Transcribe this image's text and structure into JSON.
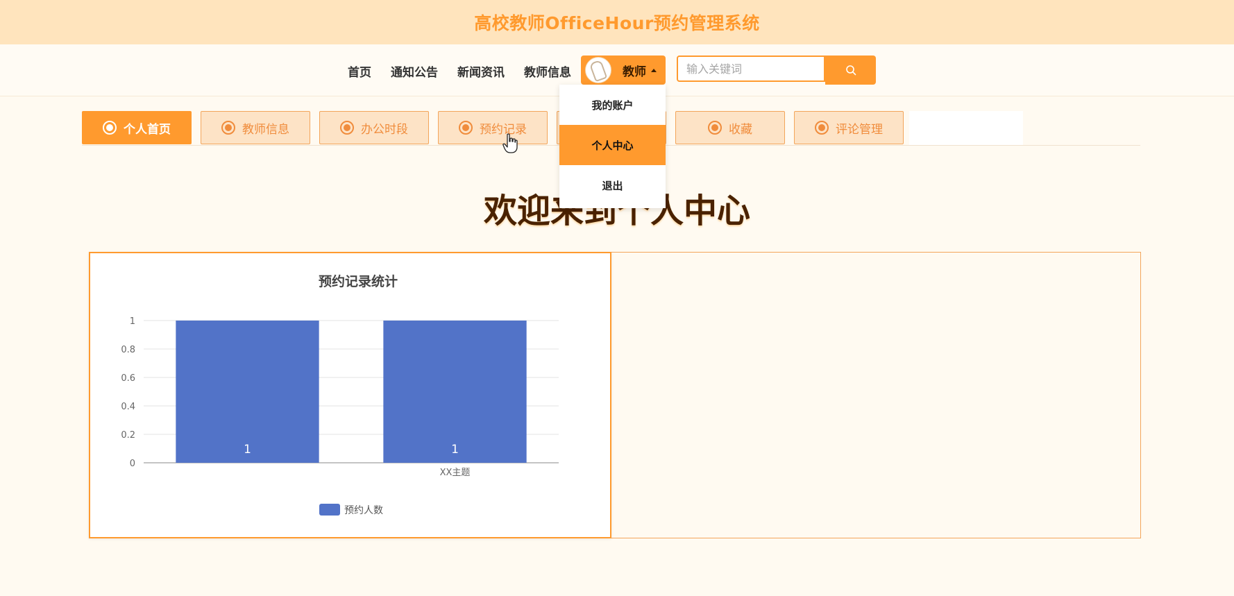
{
  "header": {
    "title": "高校教师OfficeHour预约管理系统"
  },
  "nav": {
    "links": [
      "首页",
      "通知公告",
      "新闻资讯",
      "教师信息"
    ],
    "user_label": "教师",
    "search_placeholder": "输入关键词"
  },
  "dropdown": {
    "items": [
      "我的账户",
      "个人中心",
      "退出"
    ],
    "active": "个人中心"
  },
  "tabs": [
    {
      "label": "个人首页",
      "active": true
    },
    {
      "label": "教师信息",
      "active": false
    },
    {
      "label": "办公时段",
      "active": false
    },
    {
      "label": "预约记录",
      "active": false
    },
    {
      "label": "",
      "active": false
    },
    {
      "label": "收藏",
      "active": false
    },
    {
      "label": "评论管理",
      "active": false
    }
  ],
  "welcome_text": "欢迎来到个人中心",
  "chart_data": {
    "type": "bar",
    "title": "预约记录统计",
    "categories": [
      "",
      "XX主题"
    ],
    "series": [
      {
        "name": "预约人数",
        "values": [
          1,
          1
        ],
        "color": "#5273c8"
      }
    ],
    "ylim": [
      0,
      1
    ],
    "yticks": [
      "0",
      "0.2",
      "0.4",
      "0.6",
      "0.8",
      "1"
    ],
    "data_labels": [
      "1",
      "1"
    ],
    "grid": true,
    "legend": "bottom"
  },
  "colors": {
    "accent": "#ff9a2e",
    "bar": "#5273c8",
    "heading": "#4a2200"
  }
}
